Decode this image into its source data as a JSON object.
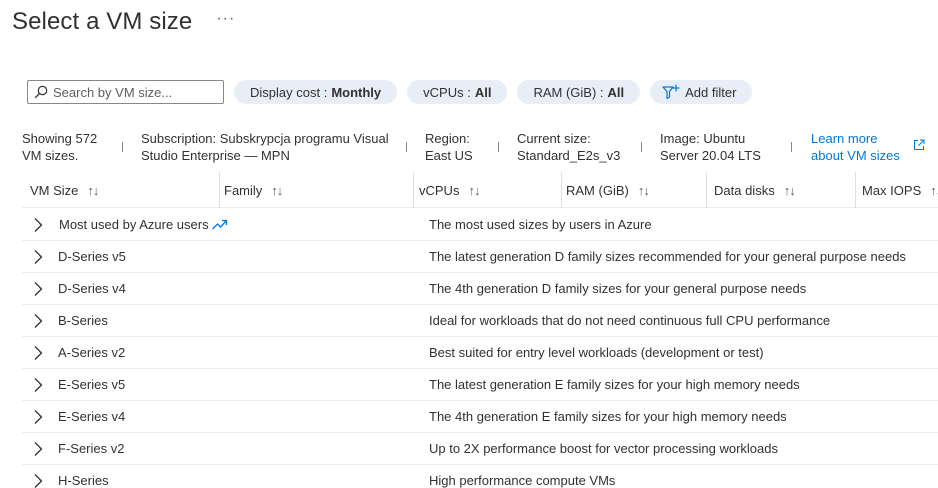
{
  "page": {
    "title": "Select a VM size",
    "more_label": "···"
  },
  "toolbar": {
    "search_placeholder": "Search by VM size...",
    "filters": [
      {
        "label": "Display cost :",
        "value": "Monthly"
      },
      {
        "label": "vCPUs :",
        "value": "All"
      },
      {
        "label": "RAM (GiB) :",
        "value": "All"
      }
    ],
    "add_filter_label": "Add filter"
  },
  "info": {
    "showing": [
      "Showing 572",
      "VM sizes."
    ],
    "subscription": [
      "Subscription: Subskrypcja programu Visual",
      "Studio Enterprise — MPN"
    ],
    "region": [
      "Region:",
      "East US"
    ],
    "current_size": [
      "Current size:",
      "Standard_E2s_v3"
    ],
    "image": [
      "Image: Ubuntu",
      "Server 20.04 LTS"
    ],
    "learn_more": [
      "Learn more",
      "about VM sizes"
    ]
  },
  "columns": [
    "VM Size",
    "Family",
    "vCPUs",
    "RAM (GiB)",
    "Data disks",
    "Max IOPS"
  ],
  "sort_glyph": "↑↓",
  "rows": [
    {
      "name": "Most used by Azure users",
      "desc": "The most used sizes by users in Azure"
    },
    {
      "name": "D-Series v5",
      "desc": "The latest generation D family sizes recommended for your general purpose needs"
    },
    {
      "name": "D-Series v4",
      "desc": "The 4th generation D family sizes for your general purpose needs"
    },
    {
      "name": "B-Series",
      "desc": "Ideal for workloads that do not need continuous full CPU performance"
    },
    {
      "name": "A-Series v2",
      "desc": "Best suited for entry level workloads (development or test)"
    },
    {
      "name": "E-Series v5",
      "desc": "The latest generation E family sizes for your high memory needs"
    },
    {
      "name": "E-Series v4",
      "desc": "The 4th generation E family sizes for your high memory needs"
    },
    {
      "name": "F-Series v2",
      "desc": "Up to 2X performance boost for vector processing workloads"
    },
    {
      "name": "H-Series",
      "desc": "High performance compute VMs"
    }
  ],
  "colors": {
    "accent": "#0078d4",
    "pill_bg": "#e8eef7",
    "text": "#323130"
  },
  "icons": {
    "search": "search-icon",
    "add_filter": "add-filter-icon",
    "external": "external-link-icon",
    "chevron": "chevron-right-icon",
    "trend": "trending-up-icon"
  }
}
